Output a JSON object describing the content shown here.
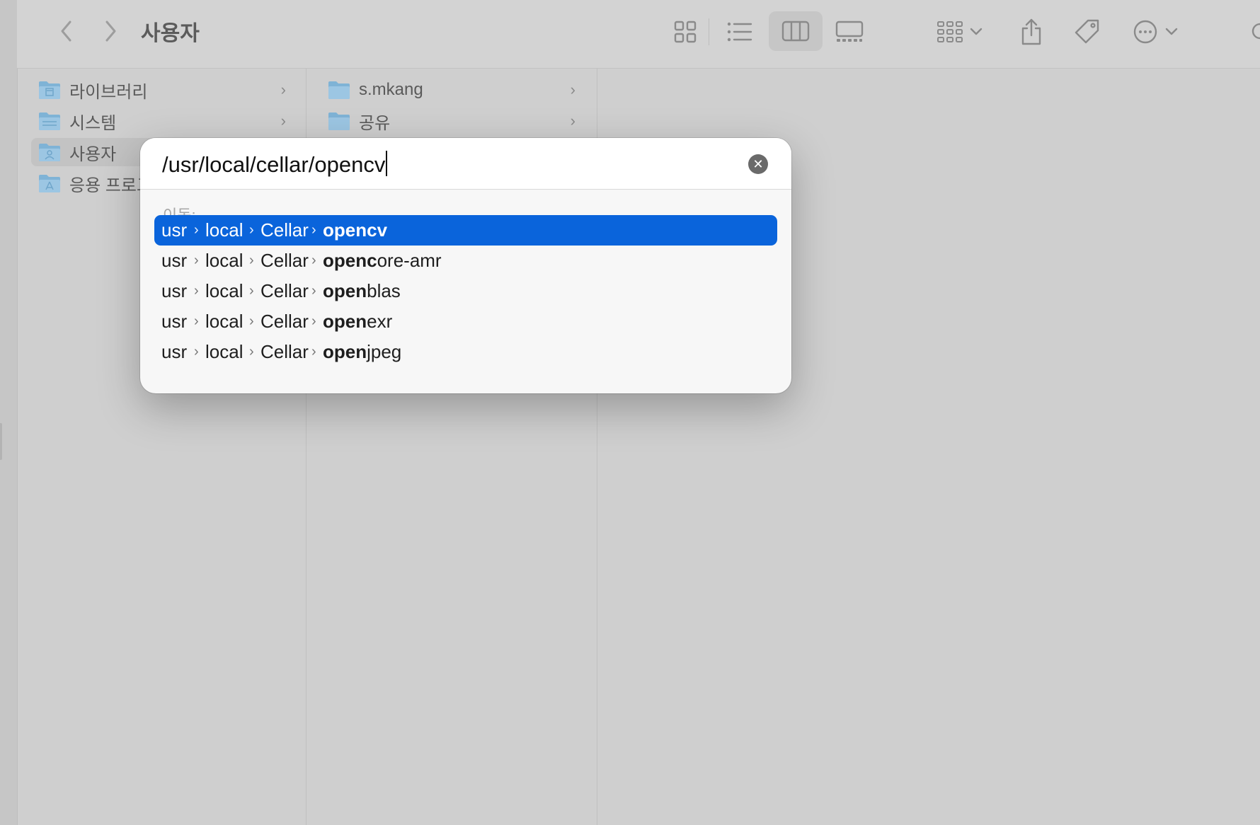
{
  "window": {
    "title": "사용자"
  },
  "toolbar": {
    "icons": [
      "chevron-left-icon",
      "chevron-right-icon",
      "icon-view-icon",
      "list-view-icon",
      "column-view-icon",
      "gallery-view-icon",
      "group-icon",
      "share-icon",
      "tag-icon",
      "more-icon"
    ],
    "active_view": "column"
  },
  "column1": {
    "items": [
      {
        "label": "라이브러리",
        "icon": "folder-icon"
      },
      {
        "label": "시스템",
        "icon": "folder-icon"
      },
      {
        "label": "사용자",
        "icon": "user-folder-icon",
        "selected": true
      },
      {
        "label": "응용 프로그",
        "icon": "apps-folder-icon"
      }
    ]
  },
  "column2": {
    "items": [
      {
        "label": "s.mkang",
        "icon": "folder-icon"
      },
      {
        "label": "공유",
        "icon": "folder-icon"
      }
    ]
  },
  "goto_dialog": {
    "path_value": "/usr/local/cellar/opencv",
    "section_label": "이동:",
    "suggestions": [
      {
        "parts": [
          "usr",
          "local",
          "Cellar"
        ],
        "match": "opencv",
        "rest": "",
        "selected": true
      },
      {
        "parts": [
          "usr",
          "local",
          "Cellar"
        ],
        "match": "openc",
        "rest": "ore-amr",
        "selected": false
      },
      {
        "parts": [
          "usr",
          "local",
          "Cellar"
        ],
        "match": "open",
        "rest": "blas",
        "selected": false
      },
      {
        "parts": [
          "usr",
          "local",
          "Cellar"
        ],
        "match": "open",
        "rest": "exr",
        "selected": false
      },
      {
        "parts": [
          "usr",
          "local",
          "Cellar"
        ],
        "match": "open",
        "rest": "jpeg",
        "selected": false
      }
    ],
    "separator": "›"
  },
  "colors": {
    "selection_blue": "#0a64db",
    "folder_blue": "#7fb3d6"
  }
}
